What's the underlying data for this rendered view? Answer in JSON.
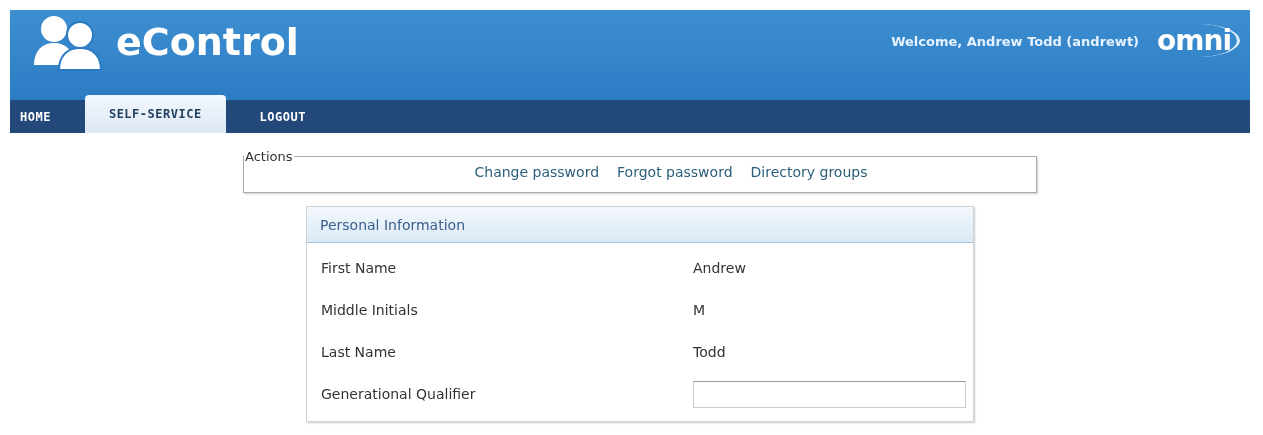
{
  "header": {
    "app_title": "eControl",
    "welcome": "Welcome, Andrew Todd (andrewt)",
    "brand": "omni"
  },
  "tabs": [
    {
      "label": "HOME",
      "selected": false
    },
    {
      "label": "SELF-SERVICE",
      "selected": true
    },
    {
      "label": "LOGOUT",
      "selected": false
    }
  ],
  "actions": {
    "legend": "Actions",
    "links": [
      "Change password",
      "Forgot password",
      "Directory groups"
    ]
  },
  "personal_information": {
    "title": "Personal Information",
    "rows": [
      {
        "kind": "text",
        "label": "First Name",
        "value": "Andrew"
      },
      {
        "kind": "text",
        "label": "Middle Initials",
        "value": "M"
      },
      {
        "kind": "text",
        "label": "Last Name",
        "value": "Todd"
      },
      {
        "kind": "input",
        "label": "Generational Qualifier"
      }
    ]
  }
}
